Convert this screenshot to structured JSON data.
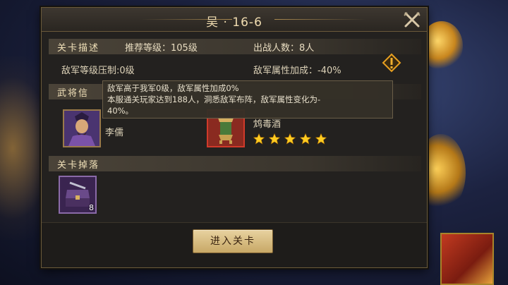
{
  "dialog": {
    "title": "吴 · 16-6"
  },
  "stage_desc": {
    "header_label": "关卡描述",
    "recommended_level": "推荐等级：105级",
    "troop_count": "出战人数：8人",
    "level_suppression": "敌军等级压制:0级",
    "attribute_bonus": "敌军属性加成：-40%"
  },
  "generals": {
    "header_label": "武将信",
    "general_name": "李儒",
    "item_name": "鸩毒酒",
    "item_stars": 5
  },
  "tooltip": {
    "line1": "敌军高于我军0级，敌军属性加成0%",
    "line2": "本服通关玩家达到188人，洞悉敌军布阵，敌军属性变化为-",
    "line3": "40%。"
  },
  "drops": {
    "header_label": "关卡掉落",
    "item_count": "8"
  },
  "actions": {
    "enter_label": "进入关卡"
  },
  "colors": {
    "accent": "#c8a866",
    "star": "#ffcc22",
    "warning": "#e8a020"
  },
  "icons": {
    "close": "close-icon",
    "warning": "warning-icon",
    "star": "star-icon"
  }
}
